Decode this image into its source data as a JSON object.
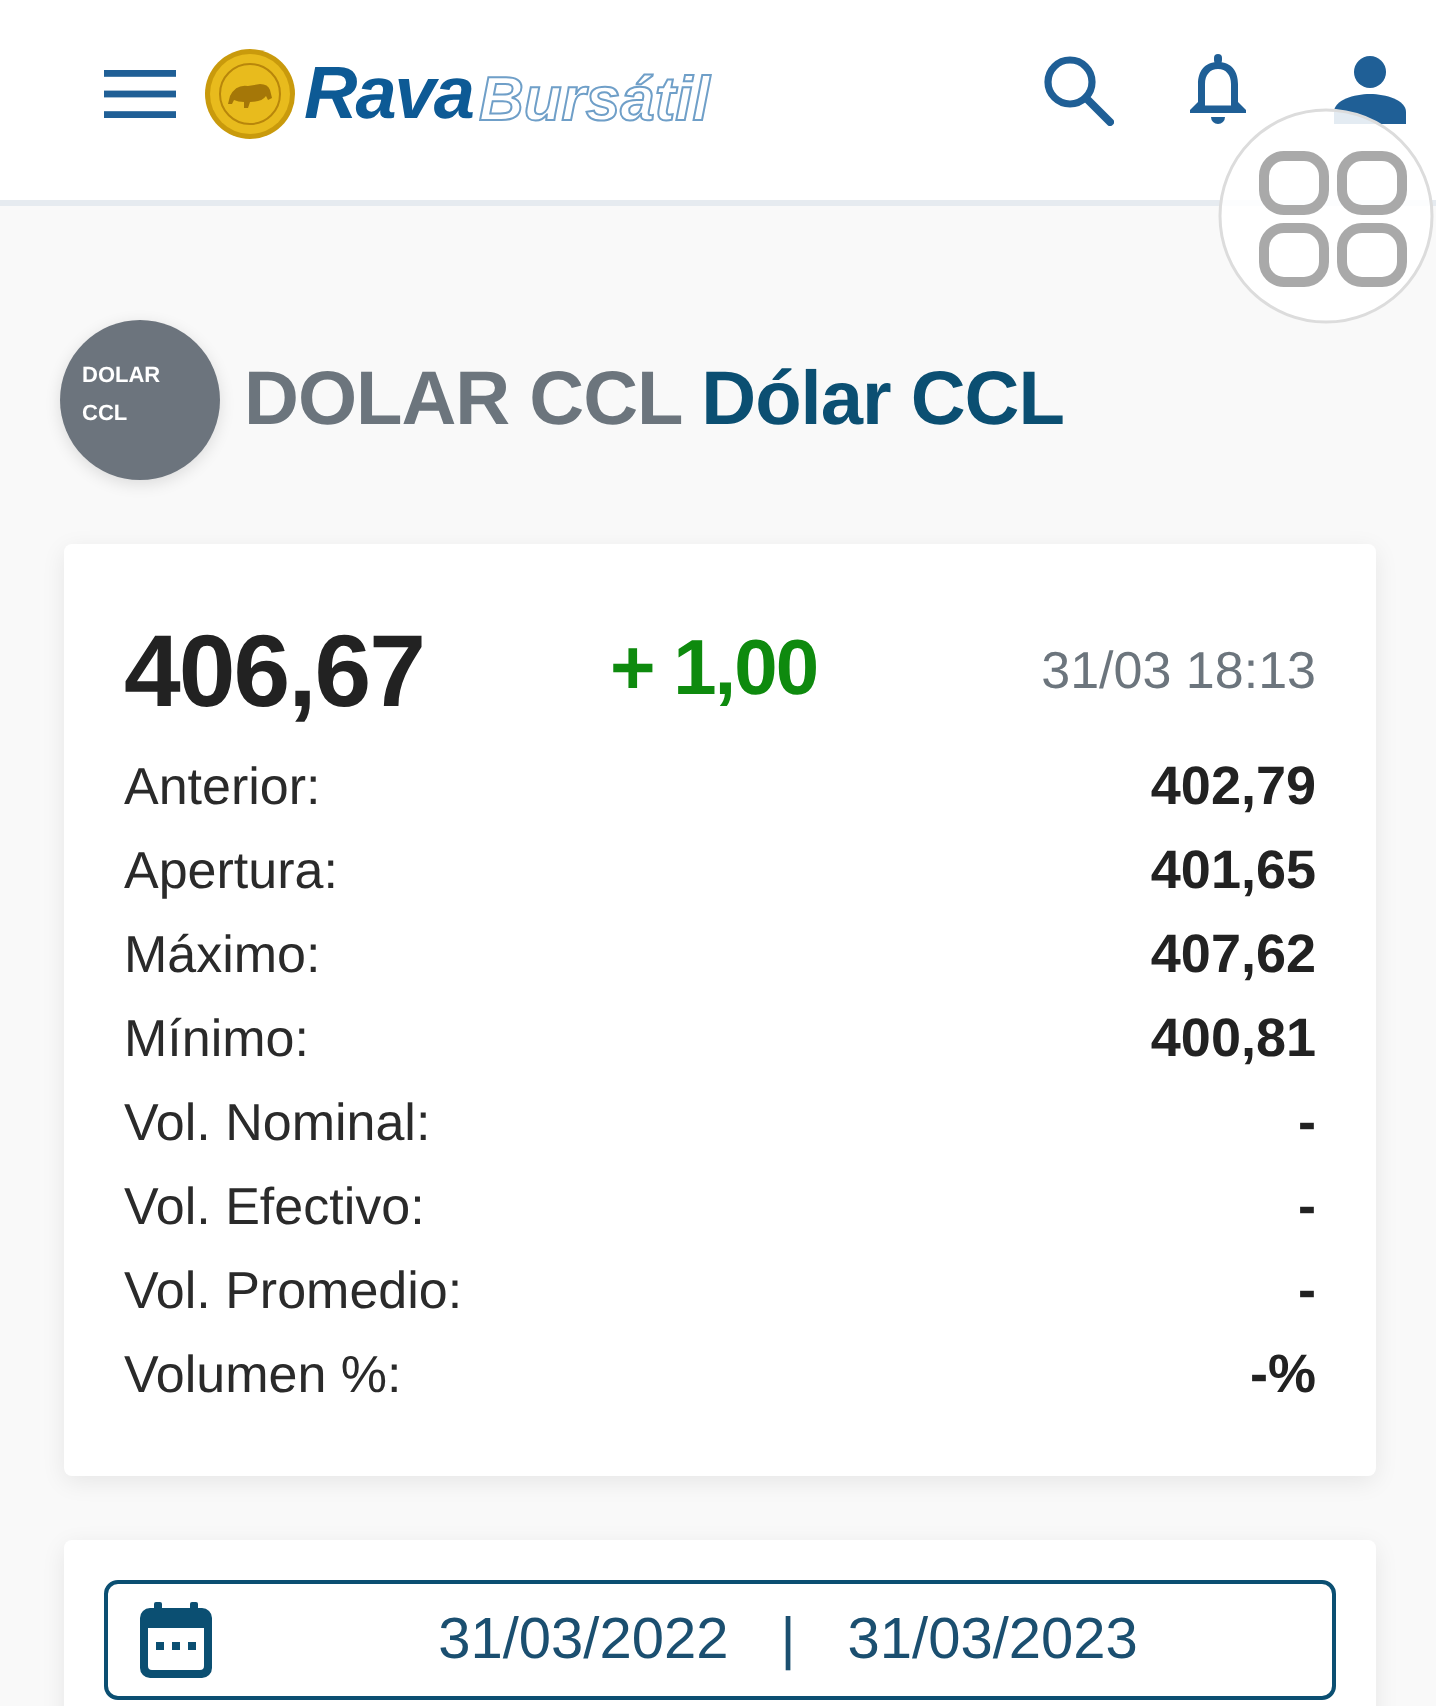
{
  "header": {
    "logo": {
      "brand": "Rava",
      "tagline": "Bursátil"
    }
  },
  "instrument": {
    "badge": "DOLAR CCL",
    "symbol": "DOLAR CCL",
    "name": "Dólar CCL"
  },
  "quote": {
    "price": "406,67",
    "change": "+ 1,00",
    "rising": true,
    "timestamp": "31/03 18:13",
    "stats": [
      {
        "label": "Anterior:",
        "value": "402,79"
      },
      {
        "label": "Apertura:",
        "value": "401,65"
      },
      {
        "label": "Máximo:",
        "value": "407,62"
      },
      {
        "label": "Mínimo:",
        "value": "400,81"
      },
      {
        "label": "Vol. Nominal:",
        "value": "-"
      },
      {
        "label": "Vol. Efectivo:",
        "value": "-"
      },
      {
        "label": "Vol. Promedio:",
        "value": "-"
      },
      {
        "label": "Volumen %:",
        "value": "-%"
      }
    ]
  },
  "date_range": {
    "from": "31/03/2022",
    "separator": "|",
    "to": "31/03/2023"
  }
}
